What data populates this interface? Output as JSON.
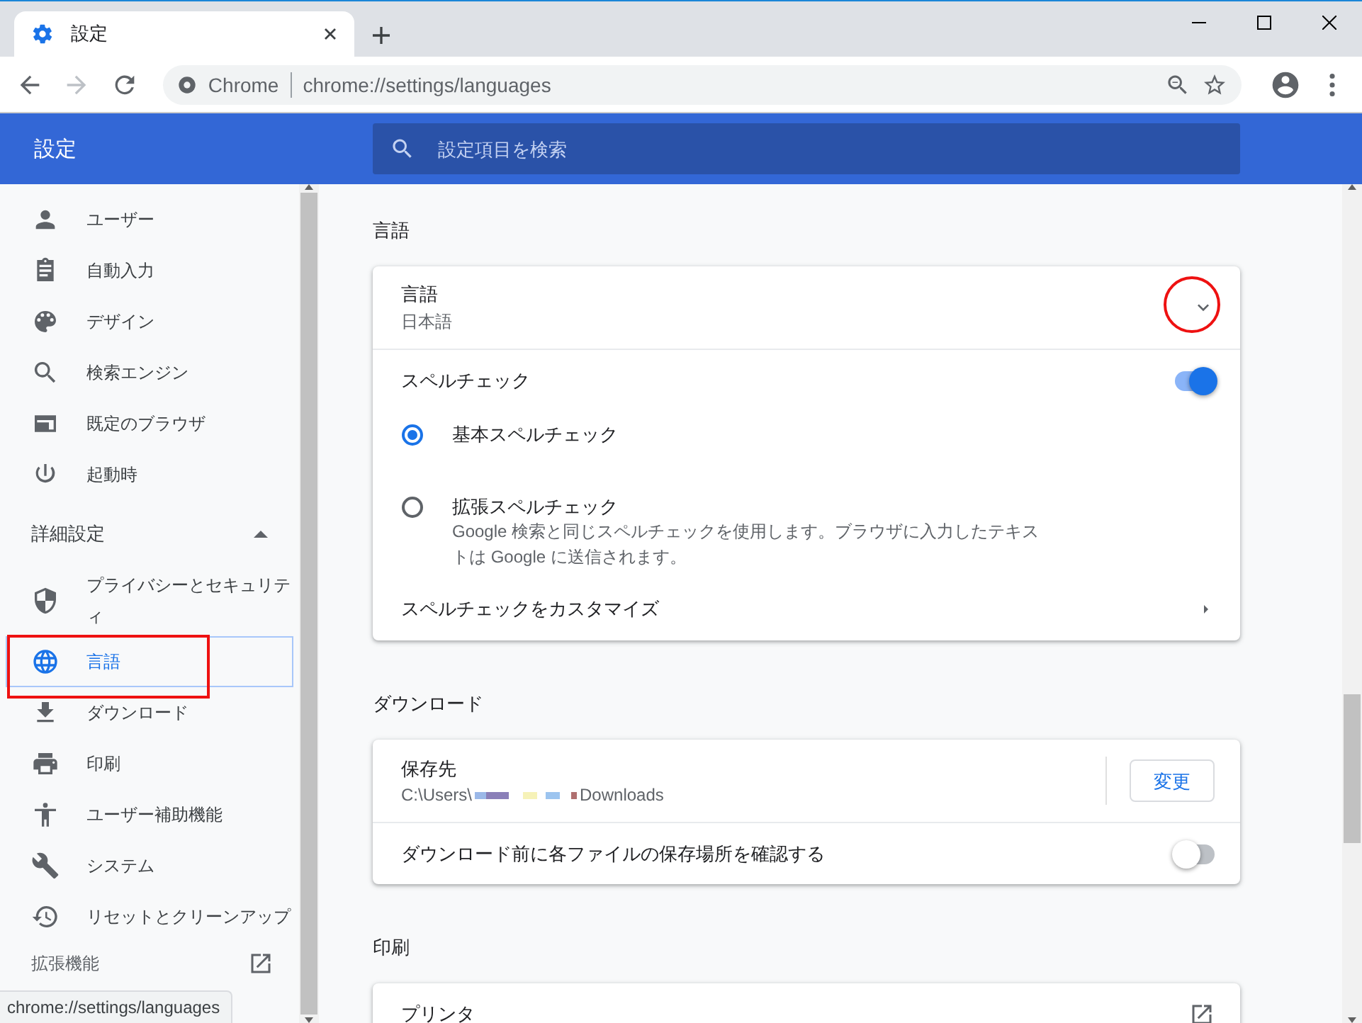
{
  "tab": {
    "title": "設定"
  },
  "toolbar": {
    "forward_disabled": true,
    "origin": "Chrome",
    "url": "chrome://settings/languages"
  },
  "header": {
    "title": "設定",
    "search_placeholder": "設定項目を検索"
  },
  "sidebar": {
    "items": [
      {
        "label": "ユーザー",
        "selected": false
      },
      {
        "label": "自動入力",
        "selected": false
      },
      {
        "label": "デザイン",
        "selected": false
      },
      {
        "label": "検索エンジン",
        "selected": false
      },
      {
        "label": "既定のブラウザ",
        "selected": false
      },
      {
        "label": "起動時",
        "selected": false
      }
    ],
    "advanced": {
      "label": "詳細設定",
      "expanded": true,
      "items": [
        {
          "label": "プライバシーとセキュリティ",
          "selected": false
        },
        {
          "label": "言語",
          "selected": true
        },
        {
          "label": "ダウンロード",
          "selected": false
        },
        {
          "label": "印刷",
          "selected": false
        },
        {
          "label": "ユーザー補助機能",
          "selected": false
        },
        {
          "label": "システム",
          "selected": false
        },
        {
          "label": "リセットとクリーンアップ",
          "selected": false
        }
      ]
    },
    "extensions": {
      "label": "拡張機能"
    }
  },
  "status_tooltip": "chrome://settings/languages",
  "sections": [
    {
      "title": "言語",
      "rows": [
        {
          "kind": "expand",
          "label": "言語",
          "value": "日本語",
          "expanded": false
        },
        {
          "kind": "toggle",
          "label": "スペルチェック",
          "on": true
        },
        {
          "kind": "radio",
          "label": "基本スペルチェック",
          "selected": true
        },
        {
          "kind": "radio",
          "label": "拡張スペルチェック",
          "description": "Google 検索と同じスペルチェックを使用します。ブラウザに入力したテキストは Google に送信されます。",
          "selected": false
        },
        {
          "kind": "submenu",
          "label": "スペルチェックをカスタマイズ"
        }
      ]
    },
    {
      "title": "ダウンロード",
      "rows": [
        {
          "kind": "location",
          "label": "保存先",
          "path_start": "C:\\Users\\",
          "path_end": "Downloads",
          "button": "変更"
        },
        {
          "kind": "toggle",
          "label": "ダウンロード前に各ファイルの保存場所を確認する",
          "on": false
        }
      ]
    },
    {
      "title": "印刷",
      "rows": [
        {
          "kind": "external",
          "label": "プリンタ"
        }
      ]
    }
  ]
}
